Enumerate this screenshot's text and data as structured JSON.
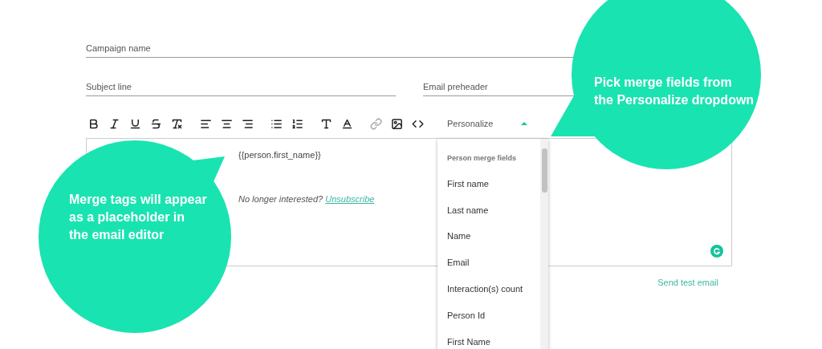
{
  "fields": {
    "campaign_name": {
      "placeholder": "Campaign name"
    },
    "subject_line": {
      "placeholder": "Subject line"
    },
    "email_preheader": {
      "placeholder": "Email preheader"
    }
  },
  "toolbar": [
    {
      "kind": "bold",
      "disabled": false
    },
    {
      "kind": "italic",
      "disabled": false
    },
    {
      "kind": "underline",
      "disabled": false
    },
    {
      "kind": "strike",
      "disabled": false
    },
    {
      "kind": "clear",
      "disabled": false
    },
    {
      "kind": "align-left",
      "disabled": false
    },
    {
      "kind": "align-center",
      "disabled": false
    },
    {
      "kind": "align-right",
      "disabled": false
    },
    {
      "kind": "bullets",
      "disabled": false
    },
    {
      "kind": "numbers",
      "disabled": false
    },
    {
      "kind": "size",
      "disabled": false
    },
    {
      "kind": "color",
      "disabled": false
    },
    {
      "kind": "link",
      "disabled": true
    },
    {
      "kind": "image",
      "disabled": false
    },
    {
      "kind": "code",
      "disabled": false
    }
  ],
  "personalize": {
    "value": "Personalize",
    "expanded": true
  },
  "editor": {
    "merge_tag": "{{person.first_name}}",
    "footer_text": "No longer interested?",
    "footer_link": "Unsubscribe"
  },
  "dropdown": {
    "header": "Person merge fields",
    "items": [
      "First name",
      "Last name",
      "Name",
      "Email",
      "Interaction(s) count",
      "Person Id",
      "First Name"
    ]
  },
  "send_test": "Send test email",
  "callouts": [
    {
      "text": "Pick merge fields from the Personalize dropdown"
    },
    {
      "text": "Merge tags will appear as a placeholder in the email editor"
    }
  ]
}
